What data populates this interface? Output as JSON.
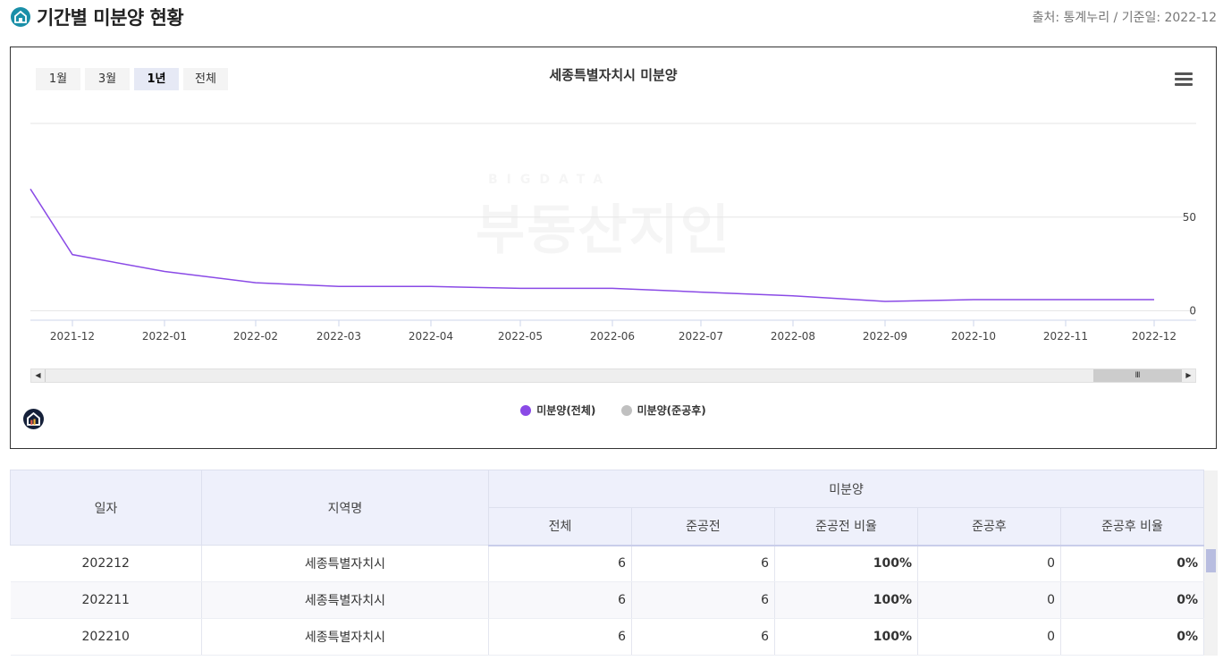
{
  "header": {
    "title": "기간별 미분양 현황",
    "source": "출처: 통계누리 / 기준일: 2022-12"
  },
  "chart": {
    "range_buttons": [
      "1월",
      "3월",
      "1년",
      "전체"
    ],
    "active_range": "1년",
    "title": "세종특별자치시 미분양",
    "legend": [
      {
        "name": "미분양(전체)",
        "color": "#8a4ae6"
      },
      {
        "name": "미분양(준공후)",
        "color": "#c0c0c0"
      }
    ],
    "watermark_top": "BIGDATA",
    "watermark": "부동산지인"
  },
  "chart_data": {
    "type": "line",
    "x": [
      "2021-11",
      "2021-12",
      "2022-01",
      "2022-02",
      "2022-03",
      "2022-04",
      "2022-05",
      "2022-06",
      "2022-07",
      "2022-08",
      "2022-09",
      "2022-10",
      "2022-11",
      "2022-12"
    ],
    "x_tick_labels": [
      "2021-12",
      "2022-01",
      "2022-02",
      "2022-03",
      "2022-04",
      "2022-05",
      "2022-06",
      "2022-07",
      "2022-08",
      "2022-09",
      "2022-10",
      "2022-11",
      "2022-12"
    ],
    "series": [
      {
        "name": "미분양(전체)",
        "values": [
          65,
          30,
          21,
          15,
          13,
          13,
          12,
          12,
          10,
          8,
          5,
          6,
          6,
          6
        ],
        "color": "#8a4ae6"
      }
    ],
    "y_ticks": [
      0,
      50
    ],
    "ylim": [
      -5,
      100
    ],
    "grid": true,
    "title": "세종특별자치시 미분양",
    "legend_position": "bottom-center"
  },
  "table": {
    "headers": {
      "date": "일자",
      "region": "지역명",
      "group": "미분양",
      "total": "전체",
      "before": "준공전",
      "before_ratio": "준공전 비율",
      "after": "준공후",
      "after_ratio": "준공후 비율"
    },
    "rows": [
      {
        "date": "202212",
        "region": "세종특별자치시",
        "total": "6",
        "before": "6",
        "before_ratio": "100%",
        "after": "0",
        "after_ratio": "0%"
      },
      {
        "date": "202211",
        "region": "세종특별자치시",
        "total": "6",
        "before": "6",
        "before_ratio": "100%",
        "after": "0",
        "after_ratio": "0%"
      },
      {
        "date": "202210",
        "region": "세종특별자치시",
        "total": "6",
        "before": "6",
        "before_ratio": "100%",
        "after": "0",
        "after_ratio": "0%"
      }
    ]
  }
}
